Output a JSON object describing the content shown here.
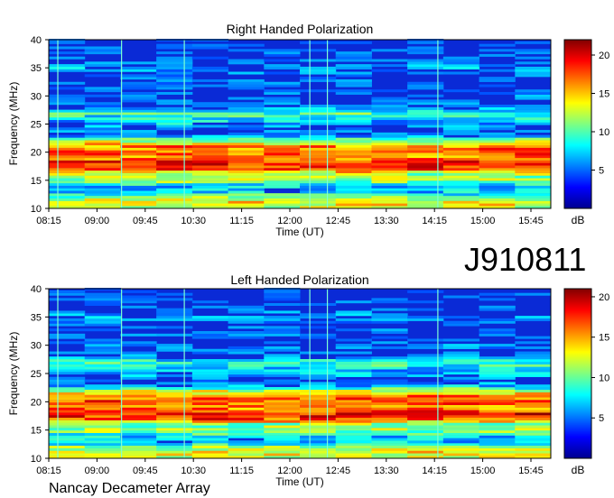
{
  "event_code": "J910811",
  "footer": "Nancay Decameter Array",
  "chart_data": [
    {
      "type": "heatmap",
      "title": "Right Handed Polarization",
      "xlabel": "Time (UT)",
      "ylabel": "Frequency (MHz)",
      "x_ticks": [
        "08:15",
        "09:00",
        "09:45",
        "10:30",
        "11:15",
        "12:00",
        "12:45",
        "13:30",
        "14:15",
        "15:00",
        "15:45"
      ],
      "y_ticks": [
        10,
        15,
        20,
        25,
        30,
        35,
        40
      ],
      "ylim": [
        10,
        40
      ],
      "colorbar": {
        "label": "dB",
        "ticks": [
          5,
          10,
          15,
          20
        ],
        "range": [
          0,
          22
        ]
      }
    },
    {
      "type": "heatmap",
      "title": "Left Handed Polarization",
      "xlabel": "Time (UT)",
      "ylabel": "Frequency (MHz)",
      "x_ticks": [
        "08:15",
        "09:00",
        "09:45",
        "10:30",
        "11:15",
        "12:00",
        "12:45",
        "13:30",
        "14:15",
        "15:00",
        "15:45"
      ],
      "y_ticks": [
        10,
        15,
        20,
        25,
        30,
        35,
        40
      ],
      "ylim": [
        10,
        40
      ],
      "colorbar": {
        "label": "dB",
        "ticks": [
          5,
          10,
          15,
          20
        ],
        "range": [
          0,
          21
        ]
      }
    }
  ]
}
